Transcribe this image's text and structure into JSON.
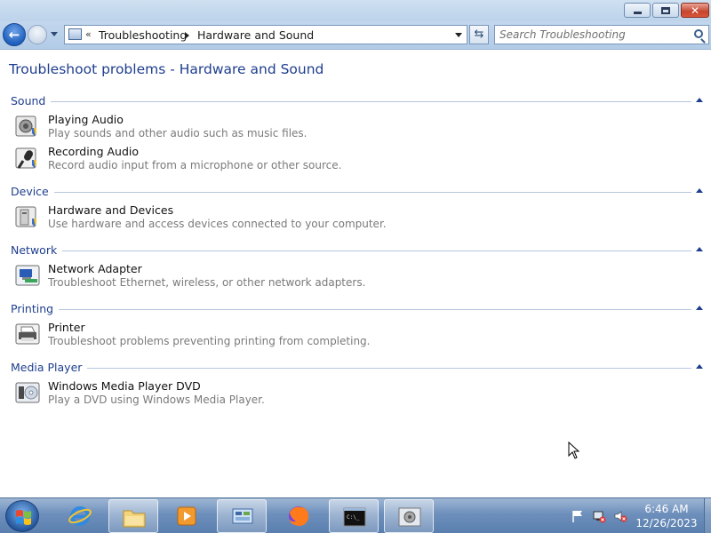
{
  "breadcrumb": {
    "chevron": "«",
    "items": [
      "Troubleshooting",
      "Hardware and Sound"
    ]
  },
  "search": {
    "placeholder": "Search Troubleshooting"
  },
  "page": {
    "title": "Troubleshoot problems - Hardware and Sound"
  },
  "groups": [
    {
      "title": "Sound",
      "items": [
        {
          "title": "Playing Audio",
          "desc": "Play sounds and other audio such as music files.",
          "icon": "speaker-icon"
        },
        {
          "title": "Recording Audio",
          "desc": "Record audio input from a microphone or other source.",
          "icon": "microphone-icon"
        }
      ]
    },
    {
      "title": "Device",
      "items": [
        {
          "title": "Hardware and Devices",
          "desc": "Use hardware and access devices connected to your computer.",
          "icon": "device-icon"
        }
      ]
    },
    {
      "title": "Network",
      "items": [
        {
          "title": "Network Adapter",
          "desc": "Troubleshoot Ethernet, wireless, or other network adapters.",
          "icon": "network-adapter-icon"
        }
      ]
    },
    {
      "title": "Printing",
      "items": [
        {
          "title": "Printer",
          "desc": "Troubleshoot problems preventing printing from completing.",
          "icon": "printer-icon"
        }
      ]
    },
    {
      "title": "Media Player",
      "items": [
        {
          "title": "Windows Media Player DVD",
          "desc": "Play a DVD using Windows Media Player.",
          "icon": "dvd-icon"
        }
      ]
    }
  ],
  "taskbar": {
    "clock_time": "6:46 AM",
    "clock_date": "12/26/2023"
  },
  "colors": {
    "link_blue": "#1e3e8e",
    "desc_gray": "#7a7a7a",
    "close_red": "#c7452d"
  }
}
